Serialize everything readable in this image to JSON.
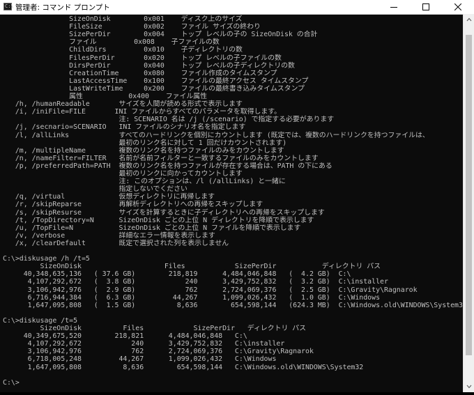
{
  "titlebar": {
    "icon_text": "C:\\",
    "title": "管理者: コマンド プロンプト"
  },
  "console": {
    "lines": [
      "                SizeOnDisk        0x001    ディスク上のサイズ",
      "                FileSize          0x002    ファイル サイズの終わり",
      "                SizePerDir        0x004    トップ レベルの子の SizeOnDisk の合計",
      "                ファイル         0x008    子ファイルの数",
      "                ChildDirs         0x010    子ディレクトリの数",
      "                FilesPerDir       0x020    トップ レベルの子ファイルの数",
      "                DirsPerDir        0x040    トップ レベルの子ディレクトリの数",
      "                CreationTime      0x080    ファイル作成のタイムスタンプ",
      "                LastAccessTime    0x100    ファイルの最終アクセス タイムスタンプ",
      "                LastWriteTime     0x200    ファイルの最終書き込みタイムスタンプ",
      "                属性           0x400    ファイル属性",
      "   /h, /humanReadable       サイズを人間が読める形式で表示します",
      "   /i, /iniFile=FILE       INI ファイルからすべてのパラメータを取得します。",
      "                            注: SCENARIO 名は /j (/scenario) で指定する必要があります",
      "   /j, /secnario=SCENARIO   INI ファイルのシナリオ名を指定します",
      "   /l, /allLinks            すべてのハードリンクを個別にカウントします (既定では、複数のハードリンクを持つファイルは、",
      "                            最初のリンク名に対して 1 回だけカウントされます)",
      "   /m, /multipleName        複数のリンク名を持つファイルのみをカウントします",
      "   /n, /nameFilter=FILTER   名前が名前フィルターと一致するファイルのみをカウントします",
      "   /p, /preferredPath=PATH  複数のリンク名を持つファイルが存在する場合は、PATH の下にある",
      "                            最初のリンクに向かってカウントします",
      "                            注: このオプションは、/l (/allLinks) と一緒に",
      "                            指定しないでください",
      "   /q, /virtual             仮想ディレクトリに再帰します",
      "   /r, /skipReparse         再解析ディレクトリへの再帰をスキップします",
      "   /s, /skipResurse         サイズを計算するときに子ディレクトリへの再帰をスキップします",
      "   /t, /TopDirectory=N      SizeOnDisk ごとの上位 N ディレクトリを降順で表示します",
      "   /u, /TopFile=N           SizeOnDisk ごとの上位 N ファイルを降順で表示します",
      "   /v, /verbose             詳細なエラー情報を表示します",
      "   /x, /clearDefault        既定で選択された列を表示しません",
      "",
      "C:\\>diskusage /h /t=5",
      "         SizeOnDisk                    Files            SizePerDir           ディレクトリ パス",
      "     40,348,635,136   ( 37.6 GB)        218,819      4,484,046,848   (  4.2 GB)  C:\\",
      "      4,107,292,672   (  3.8 GB)            240      3,429,752,832   (  3.2 GB)  C:\\installer",
      "      3,106,942,976   (  2.9 GB)            762      2,724,069,376   (  2.5 GB)  C:\\Gravity\\Ragnarok",
      "      6,716,944,384   (  6.3 GB)         44,267      1,099,026,432   (  1.0 GB)  C:\\Windows",
      "      1,647,095,808   (  1.5 GB)          8,636        654,598,144   (624.3 MB)  C:\\Windows.old\\WINDOWS\\System32",
      "",
      "C:\\>diskusage /t=5",
      "         SizeOnDisk          Files            SizePerDir   ディレクトリ パス",
      "     40,349,675,520        218,821      4,484,046,848   C:\\",
      "      4,107,292,672            240      3,429,752,832   C:\\installer",
      "      3,106,942,976            762      2,724,069,376   C:\\Gravity\\Ragnarok",
      "      6,718,005,248         44,267      1,099,026,432   C:\\Windows",
      "      1,647,095,808          8,636        654,598,144   C:\\Windows.old\\WINDOWS\\System32",
      "",
      "C:\\>"
    ]
  },
  "colors": {
    "console_bg": "#0c0c0c",
    "console_fg": "#c0c0c0",
    "titlebar_bg": "#ffffff",
    "scrollbar_bg": "#f0f0f0",
    "scrollbar_thumb": "#c1c1c1"
  },
  "icons": [
    "cmd-app-icon",
    "minimize-icon",
    "maximize-icon",
    "close-icon",
    "scroll-up-arrow-icon",
    "scroll-down-arrow-icon"
  ]
}
